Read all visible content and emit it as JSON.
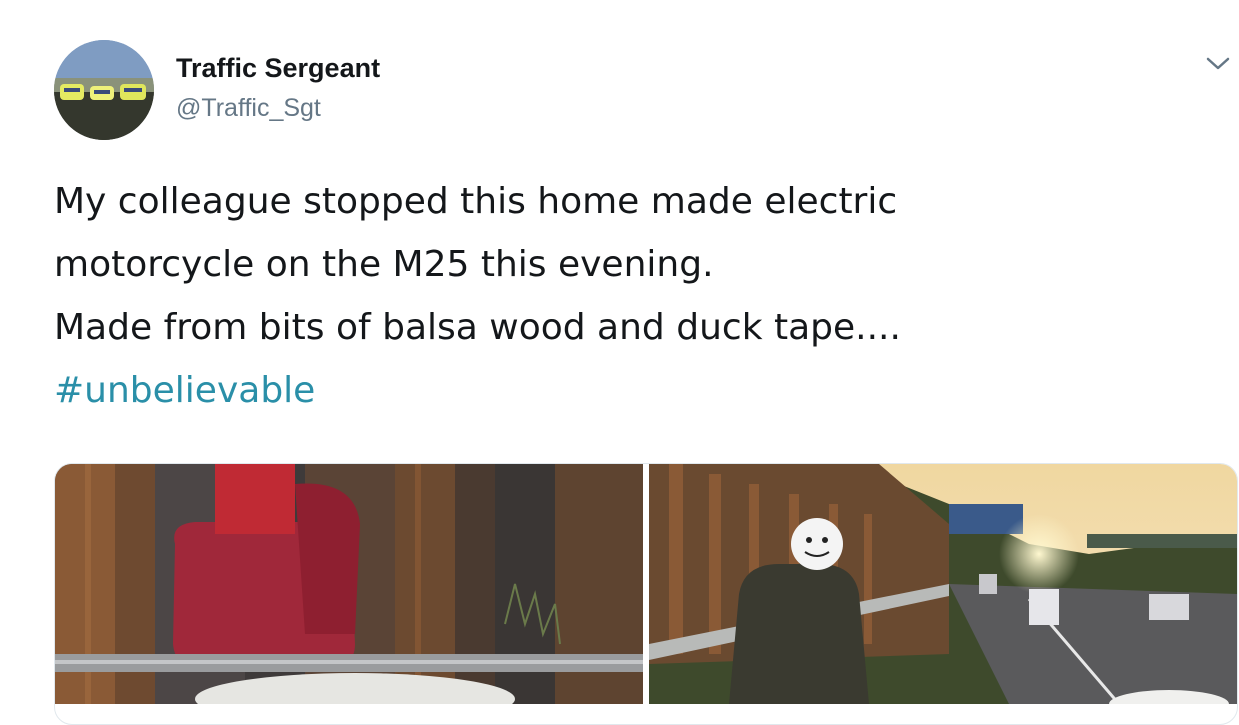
{
  "tweet": {
    "author": {
      "display_name": "Traffic Sergeant",
      "handle": "@Traffic_Sgt"
    },
    "text_lines": [
      "My colleague stopped this home made electric",
      "motorcycle on the M25 this evening.",
      "Made from bits of balsa wood and duck tape...."
    ],
    "hashtag": "#unbelievable",
    "menu_icon": "chevron-down-icon",
    "colors": {
      "hashtag": "#2a8fa8",
      "handle": "#657786"
    }
  }
}
